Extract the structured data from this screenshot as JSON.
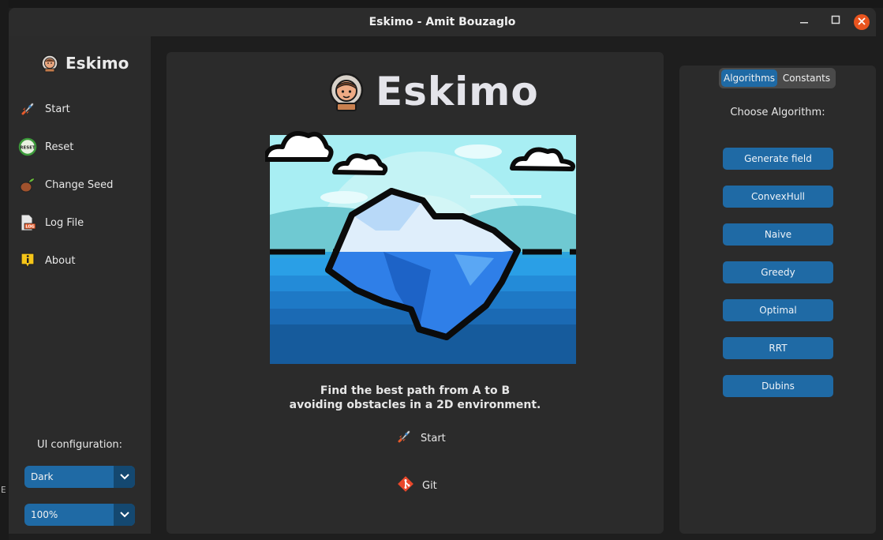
{
  "window": {
    "title": "Eskimo - Amit Bouzaglo"
  },
  "desktop": {
    "edge_letter": "E"
  },
  "sidebar": {
    "brand": "Eskimo",
    "items": [
      {
        "label": "Start",
        "icon": "rocket-icon"
      },
      {
        "label": "Reset",
        "icon": "reset-icon"
      },
      {
        "label": "Change Seed",
        "icon": "seed-icon"
      },
      {
        "label": "Log File",
        "icon": "log-file-icon"
      },
      {
        "label": "About",
        "icon": "info-icon"
      }
    ],
    "ui_config_label": "UI configuration:",
    "theme_select": {
      "value": "Dark"
    },
    "scale_select": {
      "value": "100%"
    }
  },
  "center": {
    "title": "Eskimo",
    "description_line1": "Find the best path from A to B",
    "description_line2": "avoiding obstacles in a 2D environment.",
    "start_label": "Start",
    "git_label": "Git"
  },
  "right": {
    "tabs": [
      {
        "label": "Algorithms",
        "active": true
      },
      {
        "label": "Constants",
        "active": false
      }
    ],
    "choose_label": "Choose Algorithm:",
    "buttons": [
      "Generate field",
      "ConvexHull",
      "Naive",
      "Greedy",
      "Optimal",
      "RRT",
      "Dubins"
    ]
  },
  "colors": {
    "accent": "#1f6aa5",
    "accent_dark": "#144870",
    "panel": "#2b2b2b",
    "close": "#e9541e"
  }
}
